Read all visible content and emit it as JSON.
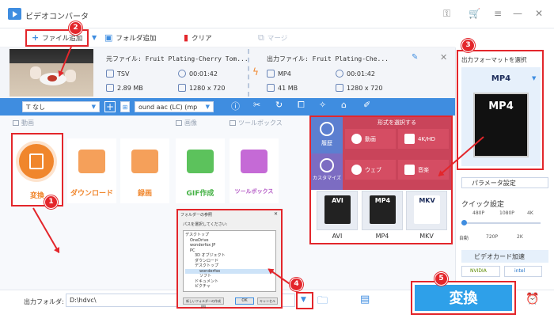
{
  "app": {
    "title": "ビデオコンバータ"
  },
  "toolbar": {
    "add_file": "ファイル追加",
    "add_folder": "フォルダ追加",
    "clear": "クリア",
    "merge": "マージ"
  },
  "file": {
    "source_label": "元ファイル: Fruit Plating-Cherry Tom...",
    "output_label": "出力ファイル: Fruit Plating-Che...",
    "src_format": "TSV",
    "src_duration": "00:01:42",
    "src_size": "2.89 MB",
    "src_resolution": "1280 x 720",
    "out_format": "MP4",
    "out_duration": "00:01:42",
    "out_size": "41 MB",
    "out_resolution": "1280 x 720"
  },
  "subbar": {
    "subtitle": "なし",
    "audio": "ound aac (LC) (mp"
  },
  "sections": {
    "video": "動画",
    "image": "画像",
    "toolbox": "ツールボックス"
  },
  "tools": [
    {
      "label": "変換"
    },
    {
      "label": "ダウンロード"
    },
    {
      "label": "録画"
    },
    {
      "label": "GIF作成"
    },
    {
      "label": "ツールボックス"
    }
  ],
  "format_popup": {
    "header": "形式を選択する",
    "history": "履歴",
    "customize": "カスタマイズ",
    "cats": [
      "動画",
      "4K/HD",
      "ウェブ",
      "音楽"
    ],
    "cards": [
      "AVI",
      "MP4",
      "MKV"
    ]
  },
  "right": {
    "select_format": "出力フォーマットを選択",
    "format": "MP4",
    "param": "パラメータ設定",
    "quick": "クイック設定",
    "q_top": [
      "480P",
      "1080P",
      "4K"
    ],
    "q_bottom": [
      "自動",
      "720P",
      "2K"
    ],
    "accel": "ビデオカード加速",
    "gpu": [
      "NVIDIA",
      "intel"
    ]
  },
  "dialog": {
    "title": "フォルダーの参照",
    "prompt": "パスを選択してください:",
    "tree": [
      "デスクトップ",
      "OneDrive",
      "wonderfox JP",
      "PC",
      "3D オブジェクト",
      "ダウンロード",
      "デスクトップ",
      "wonderfox",
      "ソフト",
      "ドキュメント",
      "ピクチャ"
    ],
    "new_folder": "新しいフォルダーの作成(M)",
    "ok": "OK",
    "cancel": "キャンセル"
  },
  "bottom": {
    "folder_label": "出力フォルダ:",
    "folder_path": "D:\\hdvc\\",
    "convert": "変換"
  },
  "badges": [
    "1",
    "2",
    "3",
    "4",
    "5"
  ]
}
